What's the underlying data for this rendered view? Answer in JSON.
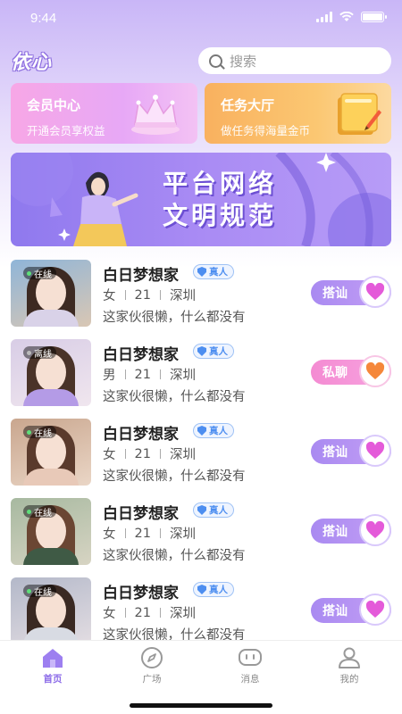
{
  "status_bar": {
    "time": "9:44"
  },
  "header": {
    "logo": "依心",
    "search_placeholder": "搜索"
  },
  "promo_cards": [
    {
      "title": "会员中心",
      "subtitle": "开通会员享权益",
      "icon": "crown-icon"
    },
    {
      "title": "任务大厅",
      "subtitle": "做任务得海量金币",
      "icon": "book-icon"
    }
  ],
  "banner": {
    "line1": "平台网络",
    "line2": "文明规范"
  },
  "users": [
    {
      "status": "在线",
      "name": "白日梦想家",
      "verified": "真人",
      "gender": "女",
      "age": "21",
      "city": "深圳",
      "bio": "这家伙很懒，什么都没有",
      "action": "搭讪",
      "action_style": "purple",
      "hair": "#3d2a22",
      "outfit": "#d9d2e8"
    },
    {
      "status": "离线",
      "name": "白日梦想家",
      "verified": "真人",
      "gender": "男",
      "age": "21",
      "city": "深圳",
      "bio": "这家伙很懒，什么都没有",
      "action": "私聊",
      "action_style": "pink",
      "hair": "#4a3328",
      "outfit": "#b49be6"
    },
    {
      "status": "在线",
      "name": "白日梦想家",
      "verified": "真人",
      "gender": "女",
      "age": "21",
      "city": "深圳",
      "bio": "这家伙很懒，什么都没有",
      "action": "搭讪",
      "action_style": "purple",
      "hair": "#5a3a2c",
      "outfit": "#e8c9b8"
    },
    {
      "status": "在线",
      "name": "白日梦想家",
      "verified": "真人",
      "gender": "女",
      "age": "21",
      "city": "深圳",
      "bio": "这家伙很懒，什么都没有",
      "action": "搭讪",
      "action_style": "purple",
      "hair": "#6b4633",
      "outfit": "#3f5a45"
    },
    {
      "status": "在线",
      "name": "白日梦想家",
      "verified": "真人",
      "gender": "女",
      "age": "21",
      "city": "深圳",
      "bio": "这家伙很懒，什么都没有",
      "action": "搭讪",
      "action_style": "purple",
      "hair": "#3a2922",
      "outfit": "#d8dbe3"
    }
  ],
  "tabbar": [
    {
      "label": "首页",
      "icon": "home-icon",
      "active": true
    },
    {
      "label": "广场",
      "icon": "compass-icon",
      "active": false
    },
    {
      "label": "消息",
      "icon": "message-icon",
      "active": false
    },
    {
      "label": "我的",
      "icon": "profile-icon",
      "active": false
    }
  ],
  "colors": {
    "accent": "#8c6ce8",
    "pink": "#f48bd2",
    "gold": "#f9b15f"
  }
}
